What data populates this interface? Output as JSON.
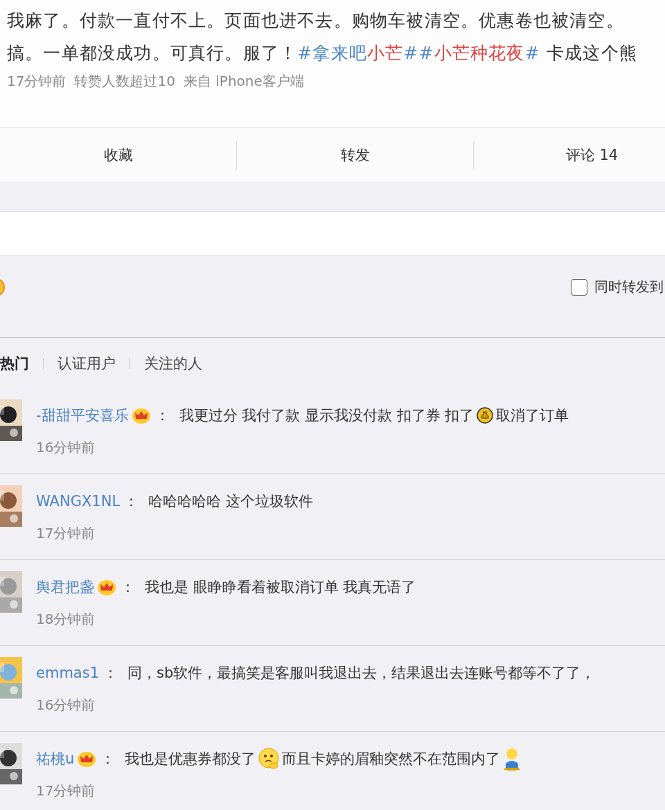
{
  "post": {
    "line_1": [
      {
        "kind": "text",
        "text": "我麻了。付款一直付不上。页面也进不去。购物车被清空。优惠卷也被清空。"
      }
    ],
    "line_2": [
      {
        "kind": "text",
        "text": "搞。一单都没成功。可真行。服了！"
      },
      {
        "kind": "topic",
        "text": "#拿来吧"
      },
      {
        "kind": "highlight",
        "text": "小芒"
      },
      {
        "kind": "topic",
        "text": "##"
      },
      {
        "kind": "highlight",
        "text": "小芒种花夜"
      },
      {
        "kind": "topic",
        "text": "#"
      },
      {
        "kind": "text",
        "text": " 卡成这个熊"
      }
    ],
    "meta": [
      "17分钟前",
      "转赞人数超过10",
      "来自 iPhone客户端"
    ]
  },
  "actions": [
    "收藏",
    "转发",
    "评论 14"
  ],
  "composer": {
    "repost_checkbox": {
      "label": "同时转发到",
      "checked": false
    }
  },
  "filter_tabs": [
    {
      "label": "热门",
      "selected": true
    },
    {
      "label": "认证用户",
      "selected": false
    },
    {
      "label": "关注的人",
      "selected": false
    }
  ],
  "comments": [
    {
      "user": "-甜甜平安喜乐",
      "vip": true,
      "separator": "：",
      "parts": [
        {
          "kind": "text",
          "text": "我更过分 我付了款 显示我没付款 扣了券 扣了"
        },
        {
          "kind": "coin"
        },
        {
          "kind": "text",
          "text": "取消了订单"
        }
      ],
      "time": "16分钟前"
    },
    {
      "user": "WANGX1NL",
      "vip": false,
      "separator": "：",
      "parts": [
        {
          "kind": "text",
          "text": "哈哈哈哈哈 这个垃圾软件"
        }
      ],
      "time": "17分钟前"
    },
    {
      "user": "舆君把盏",
      "vip": true,
      "separator": "：",
      "parts": [
        {
          "kind": "text",
          "text": "我也是 眼睁睁看着被取消订单 我真无语了"
        }
      ],
      "time": "18分钟前"
    },
    {
      "user": "emmas1",
      "vip": false,
      "separator": "：",
      "parts": [
        {
          "kind": "text",
          "text": "同，sb软件，最搞笑是客服叫我退出去，结果退出去连账号都等不了了，"
        }
      ],
      "time": "16分钟前"
    },
    {
      "user": "祐桃u",
      "vip": true,
      "separator": "：",
      "parts": [
        {
          "kind": "text",
          "text": "我也是优惠券都没了"
        },
        {
          "kind": "thinking"
        },
        {
          "kind": "text",
          "text": "而且卡婷的眉釉突然不在范围内了"
        },
        {
          "kind": "figure"
        }
      ],
      "time": "17分钟前"
    }
  ]
}
